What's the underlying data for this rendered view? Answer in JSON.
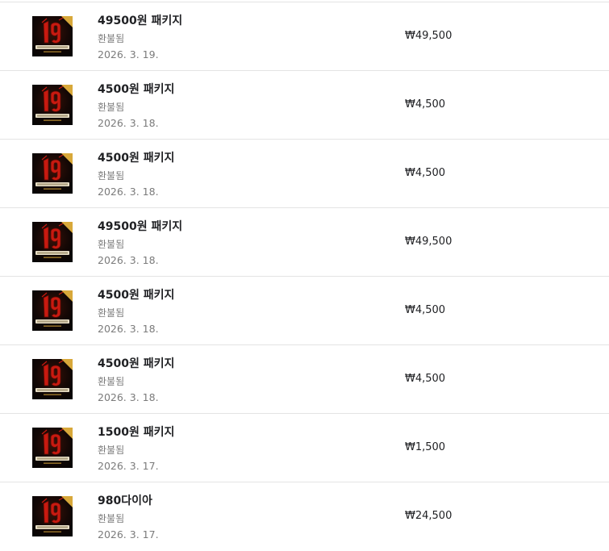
{
  "purchases": [
    {
      "title": "49500원 패키지",
      "status": "환불됨",
      "date": "2026. 3. 19.",
      "price": "₩49,500",
      "icon": "game-icon-19"
    },
    {
      "title": "4500원 패키지",
      "status": "환불됨",
      "date": "2026. 3. 18.",
      "price": "₩4,500",
      "icon": "game-icon-19"
    },
    {
      "title": "4500원 패키지",
      "status": "환불됨",
      "date": "2026. 3. 18.",
      "price": "₩4,500",
      "icon": "game-icon-19"
    },
    {
      "title": "49500원 패키지",
      "status": "환불됨",
      "date": "2026. 3. 18.",
      "price": "₩49,500",
      "icon": "game-icon-19"
    },
    {
      "title": "4500원 패키지",
      "status": "환불됨",
      "date": "2026. 3. 18.",
      "price": "₩4,500",
      "icon": "game-icon-19"
    },
    {
      "title": "4500원 패키지",
      "status": "환불됨",
      "date": "2026. 3. 18.",
      "price": "₩4,500",
      "icon": "game-icon-19"
    },
    {
      "title": "1500원 패키지",
      "status": "환불됨",
      "date": "2026. 3. 17.",
      "price": "₩1,500",
      "icon": "game-icon-19"
    },
    {
      "title": "980다이아",
      "status": "환불됨",
      "date": "2026. 3. 17.",
      "price": "₩24,500",
      "icon": "game-icon-19"
    }
  ],
  "colors": {
    "divider": "#e4e4e4",
    "text_primary": "#202124",
    "text_secondary": "#7b7b7b",
    "icon_red": "#c81a10",
    "icon_gold": "#d8a83a"
  }
}
